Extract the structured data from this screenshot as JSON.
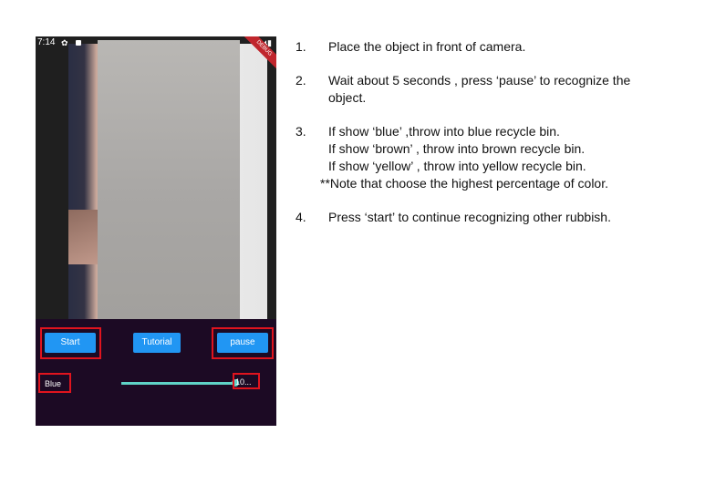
{
  "status_bar": {
    "time": "7:14",
    "gear_icon": "gear-icon",
    "lock_icon": "lock-icon",
    "right_icons": "▾◢▮",
    "debug_label": "DEBUG"
  },
  "buttons": {
    "start": "Start",
    "tutorial": "Tutorial",
    "pause": "pause"
  },
  "result": {
    "color": "Blue",
    "percentage_text": "10...",
    "progress_fraction": 0.95
  },
  "instructions": [
    {
      "number": "1.",
      "lines": [
        "Place the object in front of camera."
      ]
    },
    {
      "number": "2.",
      "lines": [
        "Wait about 5 seconds , press ‘pause’ to recognize the",
        "object."
      ]
    },
    {
      "number": "3.",
      "lines": [
        "If show ‘blue’ ,throw into blue recycle bin.",
        "If show ‘brown’ , throw into brown recycle bin.",
        "If show ‘yellow’ , throw into yellow recycle bin."
      ],
      "note": "**Note that choose the highest percentage of color."
    },
    {
      "number": "4.",
      "lines": [
        "Press ‘start’ to continue recognizing other rubbish."
      ]
    }
  ],
  "colors": {
    "button": "#2196f3",
    "highlight": "#e0141e",
    "app_background": "#1c0a24",
    "slider": "#5fd3c7"
  }
}
